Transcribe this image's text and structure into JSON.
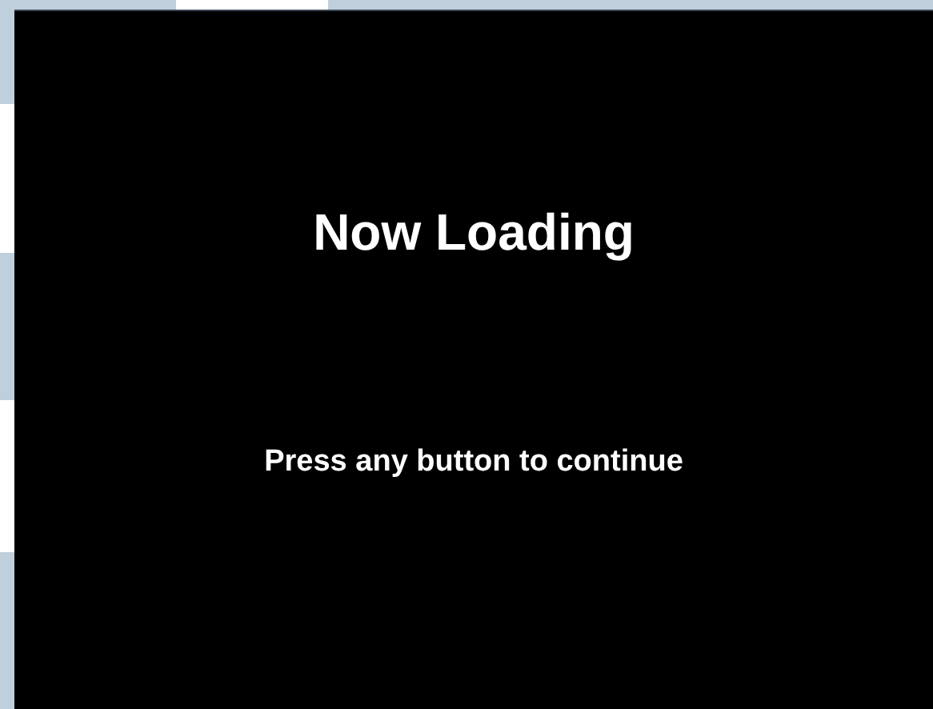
{
  "screen": {
    "title": "Now Loading",
    "prompt": "Press any button to continue"
  }
}
